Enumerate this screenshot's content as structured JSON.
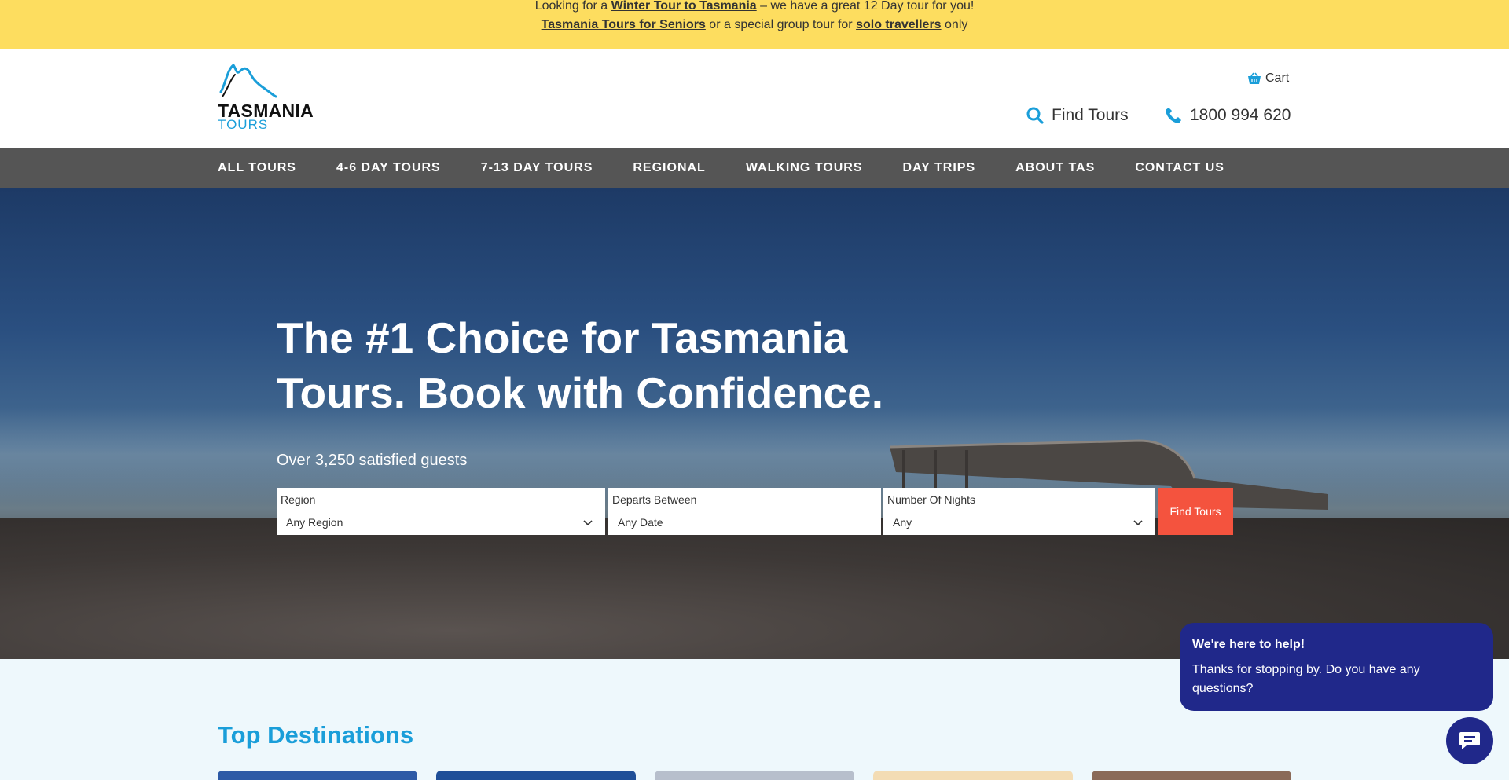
{
  "announcement": {
    "line1_pre": "Looking for a ",
    "line1_link": "Winter Tour to Tasmania",
    "line1_post": " – we have a great 12 Day tour for you!",
    "line2_link1": "Tasmania Tours for Seniors",
    "line2_mid": " or a special group tour for ",
    "line2_link2": "solo travellers",
    "line2_post": " only"
  },
  "logo": {
    "word1": "TASMANIA",
    "word2": "TOURS"
  },
  "header": {
    "cart_label": "Cart",
    "find_tours_label": "Find Tours",
    "phone": "1800 994 620"
  },
  "nav": {
    "items": [
      "ALL TOURS",
      "4-6 DAY TOURS",
      "7-13 DAY TOURS",
      "REGIONAL",
      "WALKING TOURS",
      "DAY TRIPS",
      "ABOUT TAS",
      "CONTACT US"
    ]
  },
  "hero": {
    "headline": "The #1 Choice for Tasmania Tours. Book with Confidence.",
    "guests": "Over 3,250 satisfied guests"
  },
  "search": {
    "region_label": "Region",
    "region_value": "Any Region",
    "departs_label": "Departs Between",
    "departs_value": "Any Date",
    "nights_label": "Number Of Nights",
    "nights_value": "Any",
    "button_label": "Find Tours"
  },
  "destinations": {
    "title": "Top Destinations"
  },
  "chat": {
    "title": "We're here to help!",
    "body": "Thanks for stopping by. Do you have any questions?"
  },
  "colors": {
    "accent": "#1a9ed9",
    "announce_bg": "#fddd5f",
    "nav_bg": "#555555",
    "cta": "#f4533e",
    "chat": "#20288a"
  }
}
